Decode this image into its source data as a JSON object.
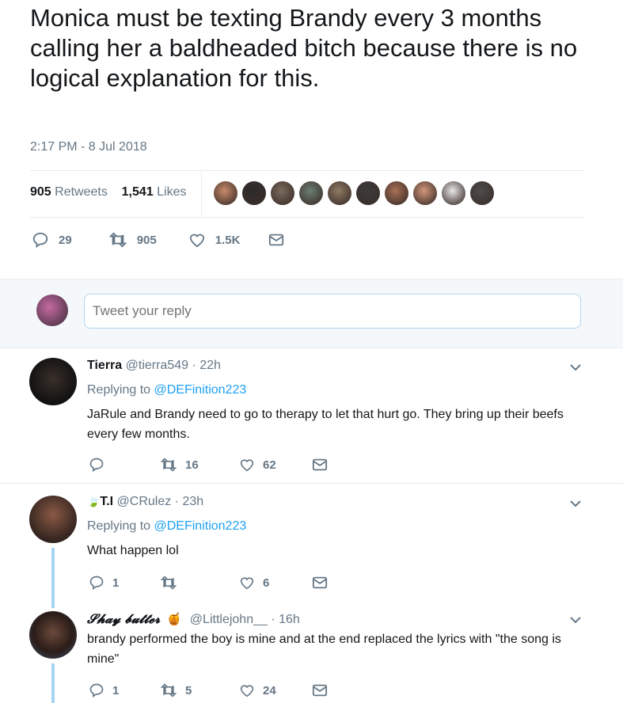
{
  "tweet": {
    "text": "Monica must be texting Brandy every 3 months calling her a baldheaded bitch because there is no logical explanation for this.",
    "timestamp": "2:17 PM - 8 Jul 2018",
    "retweets_count": "905",
    "retweets_label": "Retweets",
    "likes_count": "1,541",
    "likes_label": "Likes",
    "liker_avatar_colors": [
      "#c98a6a",
      "#2b2b2b",
      "#7a6b5d",
      "#6b7f72",
      "#8f7a63",
      "#3b3b3b",
      "#a87055",
      "#d2967b",
      "#e8e8e8",
      "#4d4d4d"
    ],
    "actions": {
      "replies": "29",
      "retweets": "905",
      "likes": "1.5K"
    }
  },
  "reply_box": {
    "placeholder": "Tweet your reply"
  },
  "replies": [
    {
      "name": "Tierra",
      "handle": "@tierra549 · 22h",
      "replying_prefix": "Replying to",
      "replying_to": "@DEFinition223",
      "text": "JaRule and Brandy need to go to therapy to let that hurt go. They bring up their beefs every few months.",
      "replies": "",
      "retweets": "16",
      "likes": "62"
    },
    {
      "name": "T.I",
      "handle": "@CRulez · 23h",
      "replying_prefix": "Replying to",
      "replying_to": "@DEFinition223",
      "text": "What happen lol",
      "replies": "1",
      "retweets": "",
      "likes": "6"
    },
    {
      "name": "𝓢𝓱𝓪𝔂 𝓫𝓾𝓽𝓽𝓮𝓻",
      "name_emoji": "🍯",
      "handle": "@Littlejohn__ · 16h",
      "text": "brandy performed the boy is mine and at the end replaced the lyrics with \"the song is mine\"",
      "replies": "1",
      "retweets": "5",
      "likes": "24"
    }
  ],
  "colors": {
    "accent": "#1da1f2",
    "muted": "#657786",
    "thread_line": "#a5d3f3"
  }
}
